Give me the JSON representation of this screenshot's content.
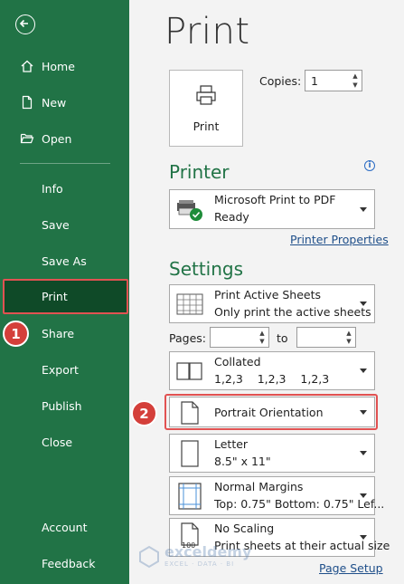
{
  "sidebar": {
    "items": {
      "home": "Home",
      "new": "New",
      "open": "Open",
      "info": "Info",
      "save": "Save",
      "save_as": "Save As",
      "print": "Print",
      "share": "Share",
      "export": "Export",
      "publish": "Publish",
      "close": "Close",
      "account": "Account",
      "feedback": "Feedback"
    }
  },
  "annotations": {
    "badge1": "1",
    "badge2": "2"
  },
  "main": {
    "title": "Print",
    "print_button": "Print",
    "copies_label": "Copies:",
    "copies_value": "1",
    "printer": {
      "heading": "Printer",
      "info_icon": "i",
      "name": "Microsoft Print to PDF",
      "status": "Ready",
      "properties_link": "Printer Properties"
    },
    "settings": {
      "heading": "Settings",
      "sheets": {
        "title": "Print Active Sheets",
        "subtitle": "Only print the active sheets"
      },
      "pages_label": "Pages:",
      "to_label": "to",
      "collated": {
        "title": "Collated",
        "subtitle": "1,2,3    1,2,3    1,2,3"
      },
      "orientation": {
        "title": "Portrait Orientation"
      },
      "paper": {
        "title": "Letter",
        "subtitle": "8.5\" x 11\""
      },
      "margins": {
        "title": "Normal Margins",
        "subtitle": "Top: 0.75\" Bottom: 0.75\" Lef..."
      },
      "scaling": {
        "title": "No Scaling",
        "subtitle": "Print sheets at their actual size",
        "icon_label": "100"
      },
      "page_setup_link": "Page Setup"
    }
  },
  "watermark": {
    "line1": "exceldemy",
    "line2": "EXCEL · DATA · BI"
  },
  "colors": {
    "sidebar": "#217346",
    "sidebar_selected": "#0f4a28",
    "highlight": "#e15252",
    "heading": "#217346",
    "link": "#1f4f8a"
  }
}
